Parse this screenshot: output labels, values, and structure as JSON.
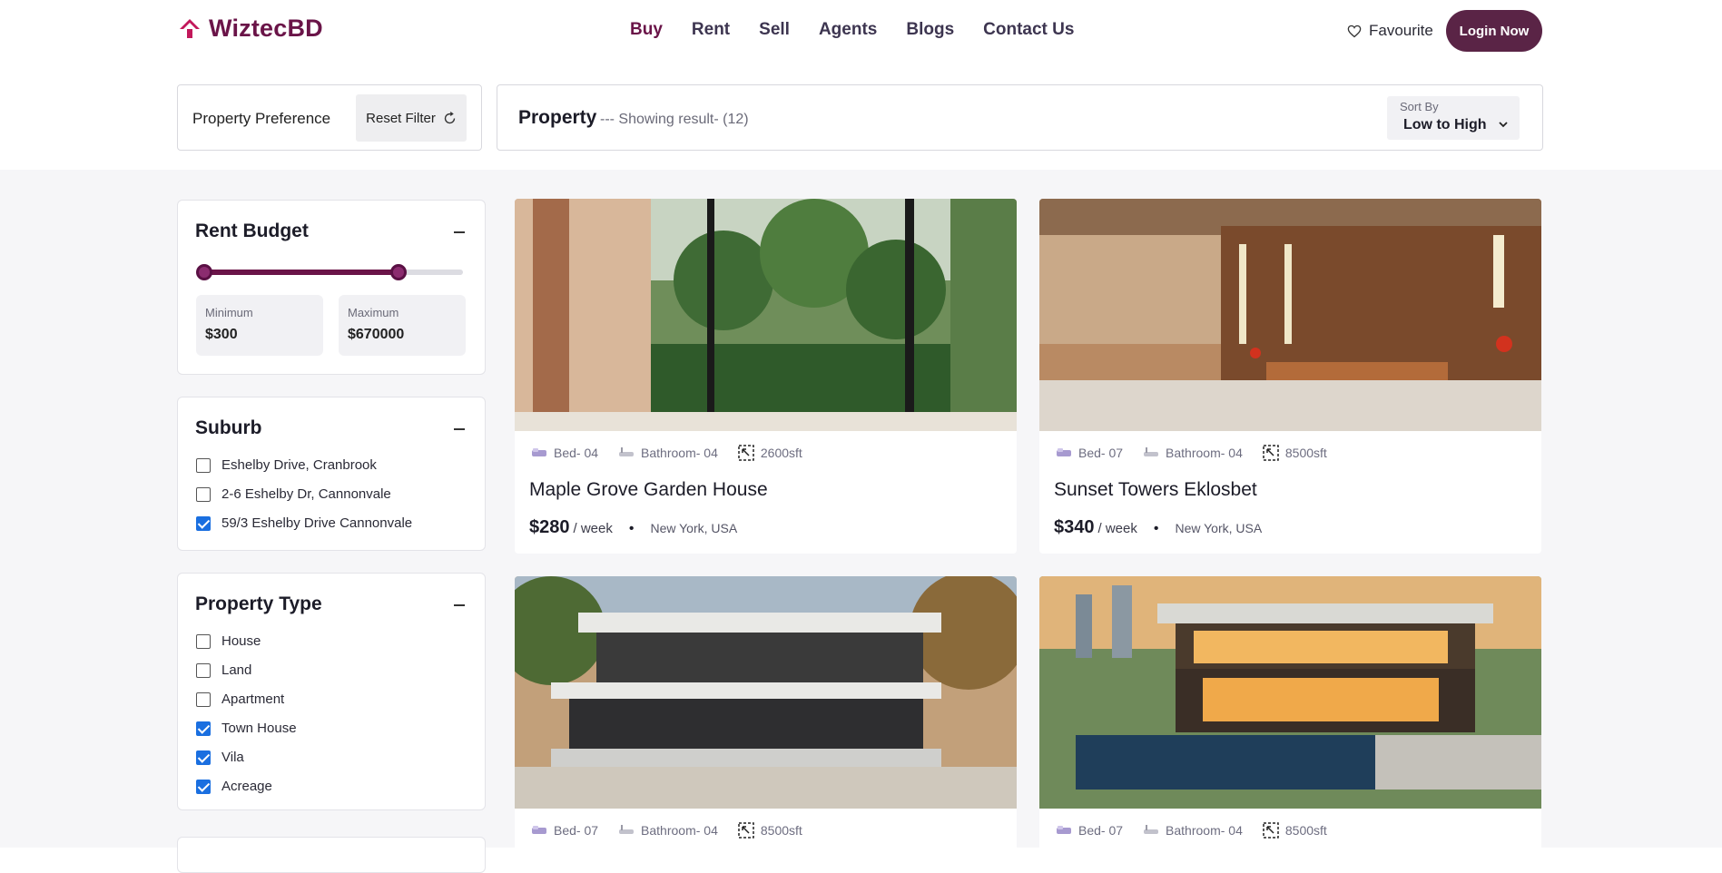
{
  "header": {
    "brand": "WiztecBD",
    "nav": [
      "Buy",
      "Rent",
      "Sell",
      "Agents",
      "Blogs",
      "Contact Us"
    ],
    "favourite": "Favourite",
    "login": "Login Now",
    "accent": "#6a1448"
  },
  "filterbar": {
    "preference": "Property Preference",
    "reset": "Reset Filter",
    "title": "Property",
    "count": "--- Showing result- (12)",
    "sort_label": "Sort By",
    "sort_value": "Low to High"
  },
  "rent_budget": {
    "title": "Rent Budget",
    "min_label": "Minimum",
    "min_value": "$300",
    "max_label": "Maximum",
    "max_value": "$670000"
  },
  "suburb": {
    "title": "Suburb",
    "items": [
      {
        "label": "Eshelby Drive, Cranbrook",
        "checked": false
      },
      {
        "label": "2-6 Eshelby Dr, Cannonvale",
        "checked": false
      },
      {
        "label": "59/3 Eshelby Drive Cannonvale",
        "checked": true
      }
    ]
  },
  "property_type": {
    "title": "Property Type",
    "items": [
      {
        "label": "House",
        "checked": false
      },
      {
        "label": "Land",
        "checked": false
      },
      {
        "label": "Apartment",
        "checked": false
      },
      {
        "label": "Town House",
        "checked": true
      },
      {
        "label": "Vila",
        "checked": true
      },
      {
        "label": "Acreage",
        "checked": true
      }
    ]
  },
  "properties": [
    {
      "bed": "Bed- 04",
      "bath": "Bathroom- 04",
      "area": "2600sft",
      "name": "Maple Grove Garden House",
      "price": "$280",
      "per": "/ week",
      "location": "New York, USA"
    },
    {
      "bed": "Bed- 07",
      "bath": "Bathroom- 04",
      "area": "8500sft",
      "name": "Sunset Towers Eklosbet",
      "price": "$340",
      "per": "/ week",
      "location": "New York, USA"
    },
    {
      "bed": "Bed- 07",
      "bath": "Bathroom- 04",
      "area": "8500sft"
    },
    {
      "bed": "Bed- 07",
      "bath": "Bathroom- 04",
      "area": "8500sft"
    }
  ]
}
